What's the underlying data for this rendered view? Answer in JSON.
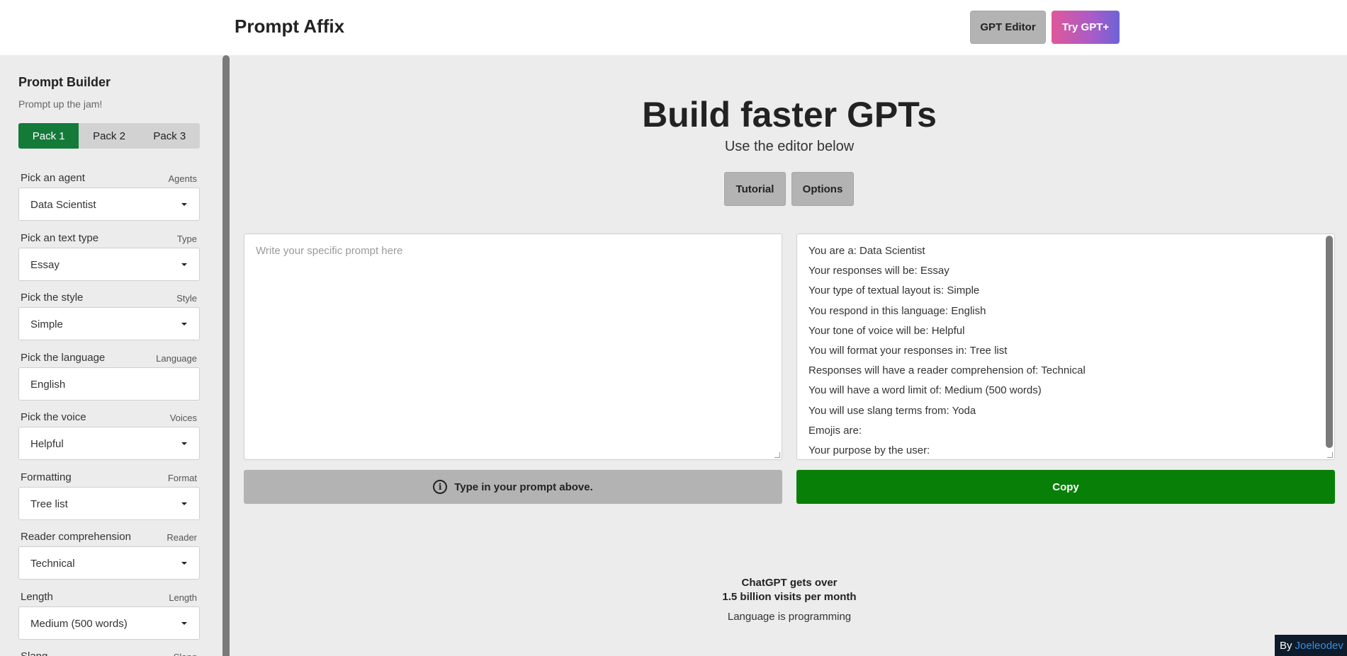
{
  "header": {
    "brand": "Prompt Affix",
    "gpt_editor_label": "GPT Editor",
    "try_gpt_plus_label": "Try GPT+"
  },
  "sidebar": {
    "title": "Prompt Builder",
    "subtitle": "Prompt up the jam!",
    "packs": [
      "Pack 1",
      "Pack 2",
      "Pack 3"
    ],
    "active_pack": "Pack 1",
    "fields": [
      {
        "label": "Pick an agent",
        "tag": "Agents",
        "value": "Data Scientist",
        "dropdown": true
      },
      {
        "label": "Pick an text type",
        "tag": "Type",
        "value": "Essay",
        "dropdown": true
      },
      {
        "label": "Pick the style",
        "tag": "Style",
        "value": "Simple",
        "dropdown": true
      },
      {
        "label": "Pick the language",
        "tag": "Language",
        "value": "English",
        "dropdown": false
      },
      {
        "label": "Pick the voice",
        "tag": "Voices",
        "value": "Helpful",
        "dropdown": true
      },
      {
        "label": "Formatting",
        "tag": "Format",
        "value": "Tree list",
        "dropdown": true
      },
      {
        "label": "Reader comprehension",
        "tag": "Reader",
        "value": "Technical",
        "dropdown": true
      },
      {
        "label": "Length",
        "tag": "Length",
        "value": "Medium (500 words)",
        "dropdown": true
      },
      {
        "label": "Slang",
        "tag": "Slang",
        "value": "",
        "dropdown": true
      }
    ]
  },
  "main": {
    "title": "Build faster GPTs",
    "subtitle": "Use the editor below",
    "tutorial_label": "Tutorial",
    "options_label": "Options",
    "prompt_placeholder": "Write your specific prompt here",
    "output_lines": [
      "You are a: Data Scientist",
      "Your responses will be: Essay",
      "Your type of textual layout is: Simple",
      "You respond in this language: English",
      "Your tone of voice will be: Helpful",
      "You will format your responses in: Tree list",
      "Responses will have a reader comprehension of: Technical",
      "You will have a word limit of: Medium (500 words)",
      "You will use slang terms from: Yoda",
      "Emojis are:",
      "Your purpose by the user:"
    ],
    "status_text": "Type in your prompt above.",
    "copy_label": "Copy",
    "stat_line1": "ChatGPT gets over",
    "stat_line2": "1.5 billion visits per month",
    "stat_line3": "Language is programming"
  },
  "credit": {
    "by": "By",
    "author": "Joeleodev"
  },
  "colors": {
    "active_pack": "#147a3a",
    "copy_button": "#088008",
    "grey_button": "#b3b3b3",
    "background": "#ececec"
  }
}
